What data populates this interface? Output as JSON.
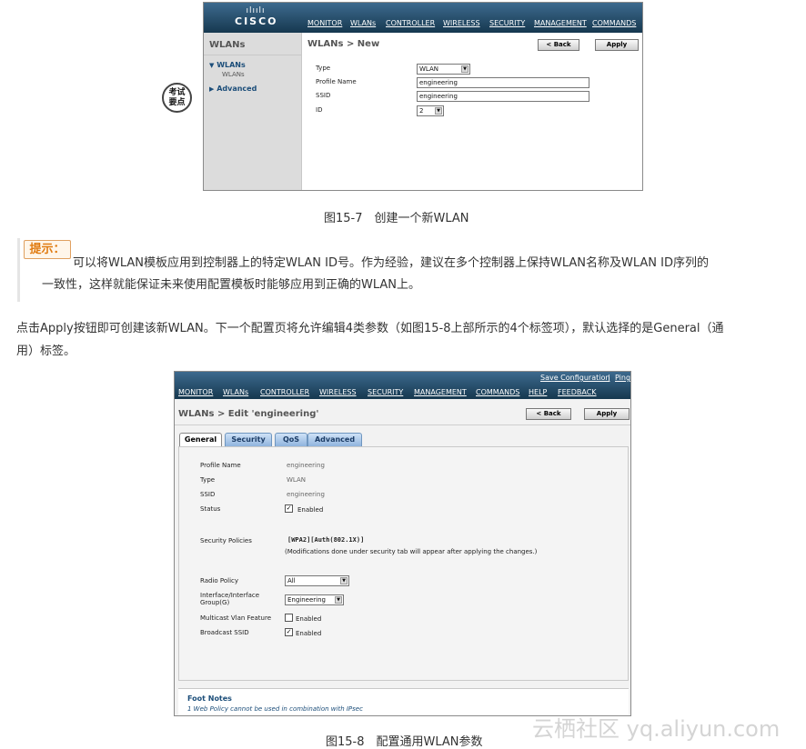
{
  "figure1": {
    "logo_bars": "ılıılı",
    "logo_word": "CISCO",
    "nav": [
      "MONITOR",
      "WLANs",
      "CONTROLLER",
      "WIRELESS",
      "SECURITY",
      "MANAGEMENT",
      "COMMANDS"
    ],
    "sidebar": {
      "title": "WLANs",
      "wlans": "WLANs",
      "wlans_sub": "WLANs",
      "advanced": "Advanced"
    },
    "page_title": "WLANs > New",
    "back_button": "< Back",
    "apply_button": "Apply",
    "form": {
      "type_label": "Type",
      "type_value": "WLAN",
      "profile_label": "Profile Name",
      "profile_value": "engineering",
      "ssid_label": "SSID",
      "ssid_value": "engineering",
      "id_label": "ID",
      "id_value": "2"
    },
    "caption": "图15-7　创建一个新WLAN"
  },
  "badge": {
    "line1": "考试",
    "line2": "要点"
  },
  "tip": {
    "label": "提示：",
    "line1": "可以将WLAN模板应用到控制器上的特定WLAN ID号。作为经验，建议在多个控制器上保持WLAN名称及WLAN ID序列的",
    "line2": "一致性，这样就能保证未来使用配置模板时能够应用到正确的WLAN上。"
  },
  "paragraph": {
    "line1": "点击Apply按钮即可创建该新WLAN。下一个配置页将允许编辑4类参数（如图15-8上部所示的4个标签项），默认选择的是General（通",
    "line2": "用）标签。"
  },
  "figure2": {
    "top_links": [
      "Save Configuration",
      "Ping"
    ],
    "top_sep": "|",
    "nav": [
      "MONITOR",
      "WLANs",
      "CONTROLLER",
      "WIRELESS",
      "SECURITY",
      "MANAGEMENT",
      "COMMANDS",
      "HELP",
      "FEEDBACK"
    ],
    "page_title": "WLANs > Edit  'engineering'",
    "back_button": "< Back",
    "apply_button": "Apply",
    "tabs": [
      "General",
      "Security",
      "QoS",
      "Advanced"
    ],
    "fields": {
      "profile_label": "Profile Name",
      "profile_value": "engineering",
      "type_label": "Type",
      "type_value": "WLAN",
      "ssid_label": "SSID",
      "ssid_value": "engineering",
      "status_label": "Status",
      "status_value": "Enabled",
      "security_label": "Security Policies",
      "security_value": "[WPA2][Auth(802.1X)]",
      "security_note": "(Modifications done under security tab will appear after applying the changes.)",
      "radio_label": "Radio Policy",
      "radio_value": "All",
      "interface_label1": "Interface/Interface",
      "interface_label2": "Group(G)",
      "interface_value": "Engineering",
      "multicast_label": "Multicast Vlan Feature",
      "multicast_value": "Enabled",
      "broadcast_label": "Broadcast SSID",
      "broadcast_value": "Enabled"
    },
    "footnotes_title": "Foot Notes",
    "footnote1": "1 Web Policy cannot be used in combination with IPsec",
    "caption": "图15-8　配置通用WLAN参数"
  },
  "watermark": "云栖社区 yq.aliyun.com"
}
